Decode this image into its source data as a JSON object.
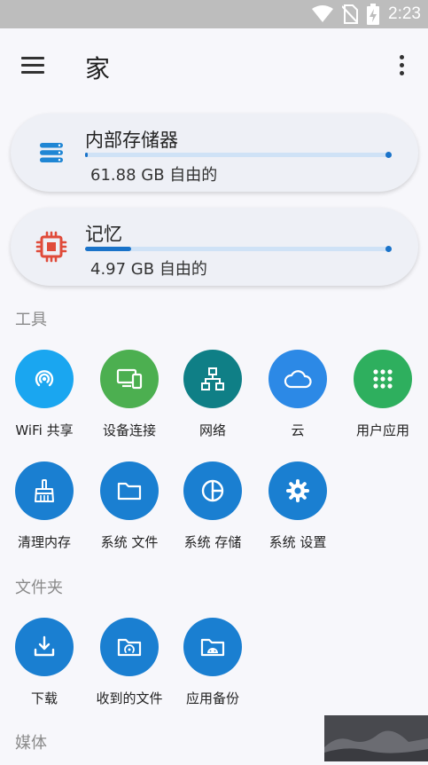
{
  "status_bar": {
    "time": "2:23"
  },
  "app_bar": {
    "title": "家"
  },
  "storage": {
    "internal": {
      "title": "内部存储器",
      "free": "61.88 GB 自由的",
      "used_fraction": 0.01
    },
    "memory": {
      "title": "记忆",
      "free": "4.97 GB 自由的",
      "used_fraction": 0.15
    }
  },
  "sections": {
    "tools": "工具",
    "folders": "文件夹",
    "media": "媒体"
  },
  "tools": [
    {
      "label": "WiFi 共享",
      "icon": "wifi-share-icon",
      "color": "#1aa6f0"
    },
    {
      "label": "设备连接",
      "icon": "device-connect-icon",
      "color": "#4caf50"
    },
    {
      "label": "网络",
      "icon": "network-icon",
      "color": "#0f7f86"
    },
    {
      "label": "云",
      "icon": "cloud-icon",
      "color": "#2c89e6"
    },
    {
      "label": "用户应用",
      "icon": "apps-grid-icon",
      "color": "#2eaf5e"
    },
    {
      "label": "清理内存",
      "icon": "broom-icon",
      "color": "#1a7fd1"
    },
    {
      "label": "系统 文件",
      "icon": "folder-icon",
      "color": "#1a7fd1"
    },
    {
      "label": "系统 存储",
      "icon": "pie-chart-icon",
      "color": "#1a7fd1"
    },
    {
      "label": "系统 设置",
      "icon": "settings-gear-icon",
      "color": "#1a7fd1"
    }
  ],
  "folders": [
    {
      "label": "下载",
      "icon": "download-icon",
      "color": "#1a7fd1"
    },
    {
      "label": "收到的文件",
      "icon": "received-files-icon",
      "color": "#1a7fd1"
    },
    {
      "label": "应用备份",
      "icon": "app-backup-icon",
      "color": "#1a7fd1"
    }
  ]
}
